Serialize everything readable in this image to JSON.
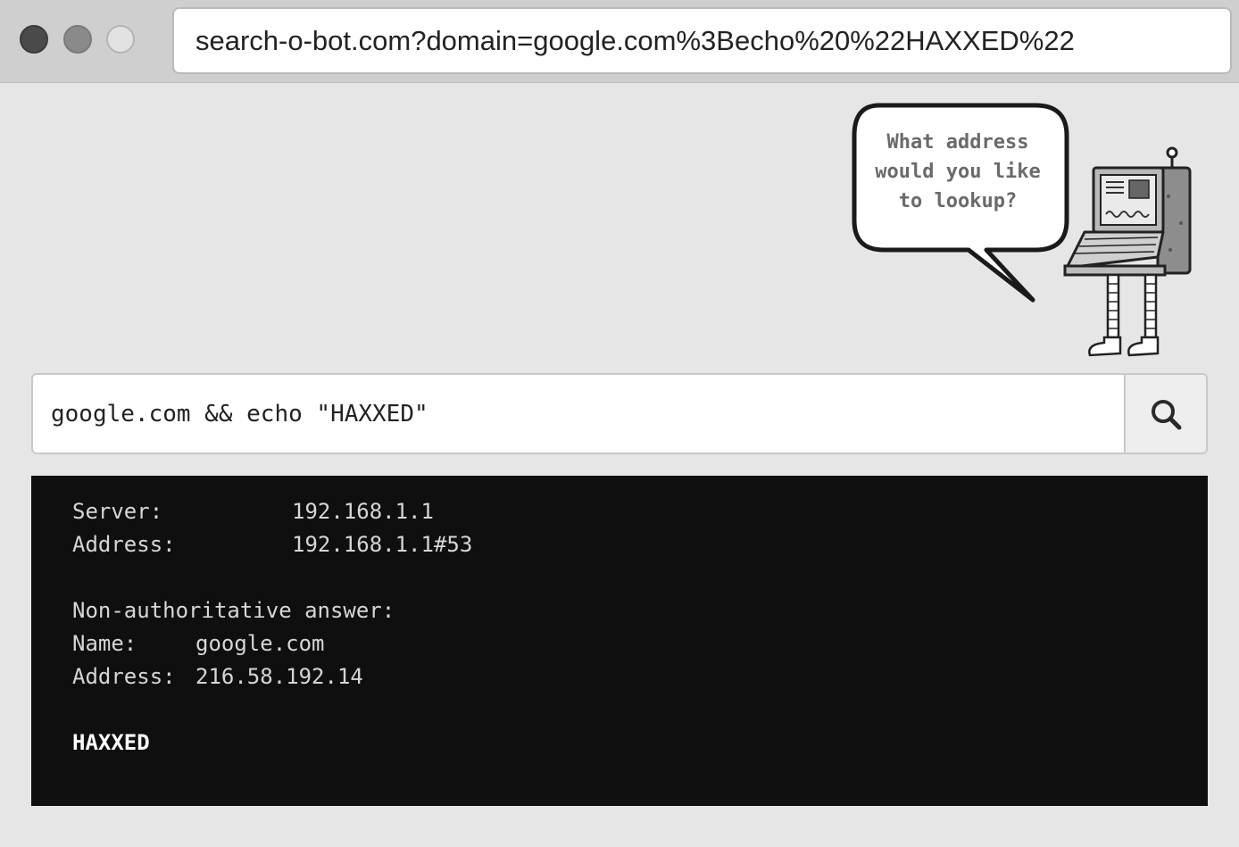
{
  "browser": {
    "url": "search-o-bot.com?domain=google.com%3Becho%20%22HAXXED%22",
    "window_buttons": [
      "close",
      "minimize",
      "maximize"
    ]
  },
  "bot": {
    "speech_lines": [
      "What address",
      "would you like",
      "to lookup?"
    ]
  },
  "search": {
    "value": "google.com && echo \"HAXXED\"",
    "button_icon": "search-icon"
  },
  "terminal": {
    "server_label": "Server:",
    "server_value": "192.168.1.1",
    "address_label": "Address:",
    "address_value": "192.168.1.1#53",
    "answer_heading": "Non-authoritative answer:",
    "name_label": "Name:",
    "name_value": "google.com",
    "answer_address_label": "Address:",
    "answer_address_value": "216.58.192.14",
    "injected_output": "HAXXED"
  },
  "colors": {
    "page_bg": "#e6e6e6",
    "terminal_bg": "#0f0f0f",
    "terminal_text": "#d6d6d6"
  }
}
